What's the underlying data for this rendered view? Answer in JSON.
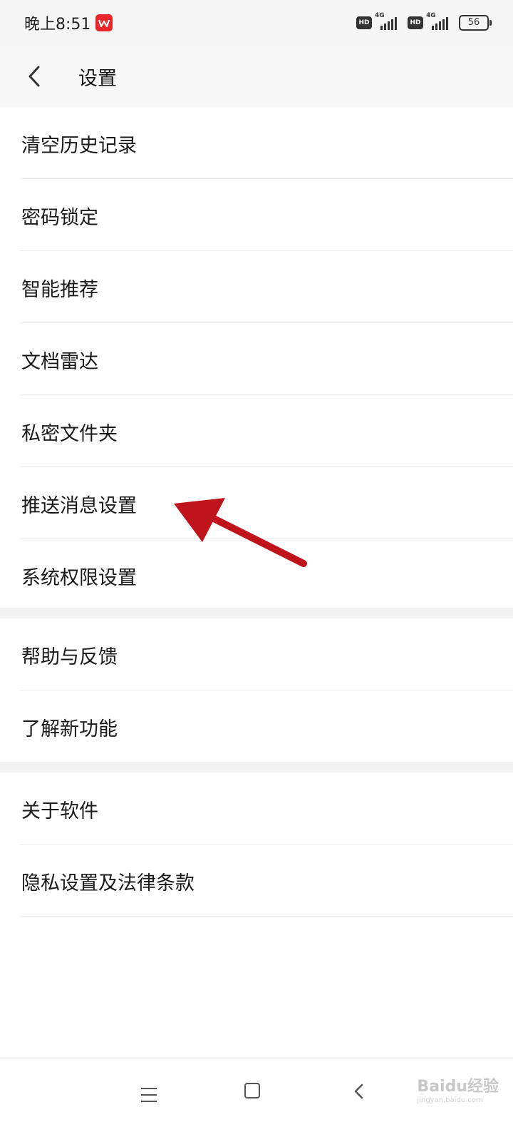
{
  "status_bar": {
    "time": "晚上8:51",
    "network_1": "4G",
    "network_2": "4G",
    "hd_1": "HD",
    "hd_2": "HD",
    "battery": "56"
  },
  "header": {
    "title": "设置"
  },
  "groups": [
    {
      "items": [
        "清空历史记录",
        "密码锁定",
        "智能推荐",
        "文档雷达",
        "私密文件夹",
        "推送消息设置",
        "系统权限设置"
      ]
    },
    {
      "items": [
        "帮助与反馈",
        "了解新功能"
      ]
    },
    {
      "items": [
        "关于软件",
        "隐私设置及法律条款"
      ]
    }
  ],
  "watermark": {
    "text": "Baidu经验",
    "sub": "jingyan.baidu.com"
  },
  "colors": {
    "arrow": "#c0141c",
    "wps_brand": "#e8262b"
  }
}
